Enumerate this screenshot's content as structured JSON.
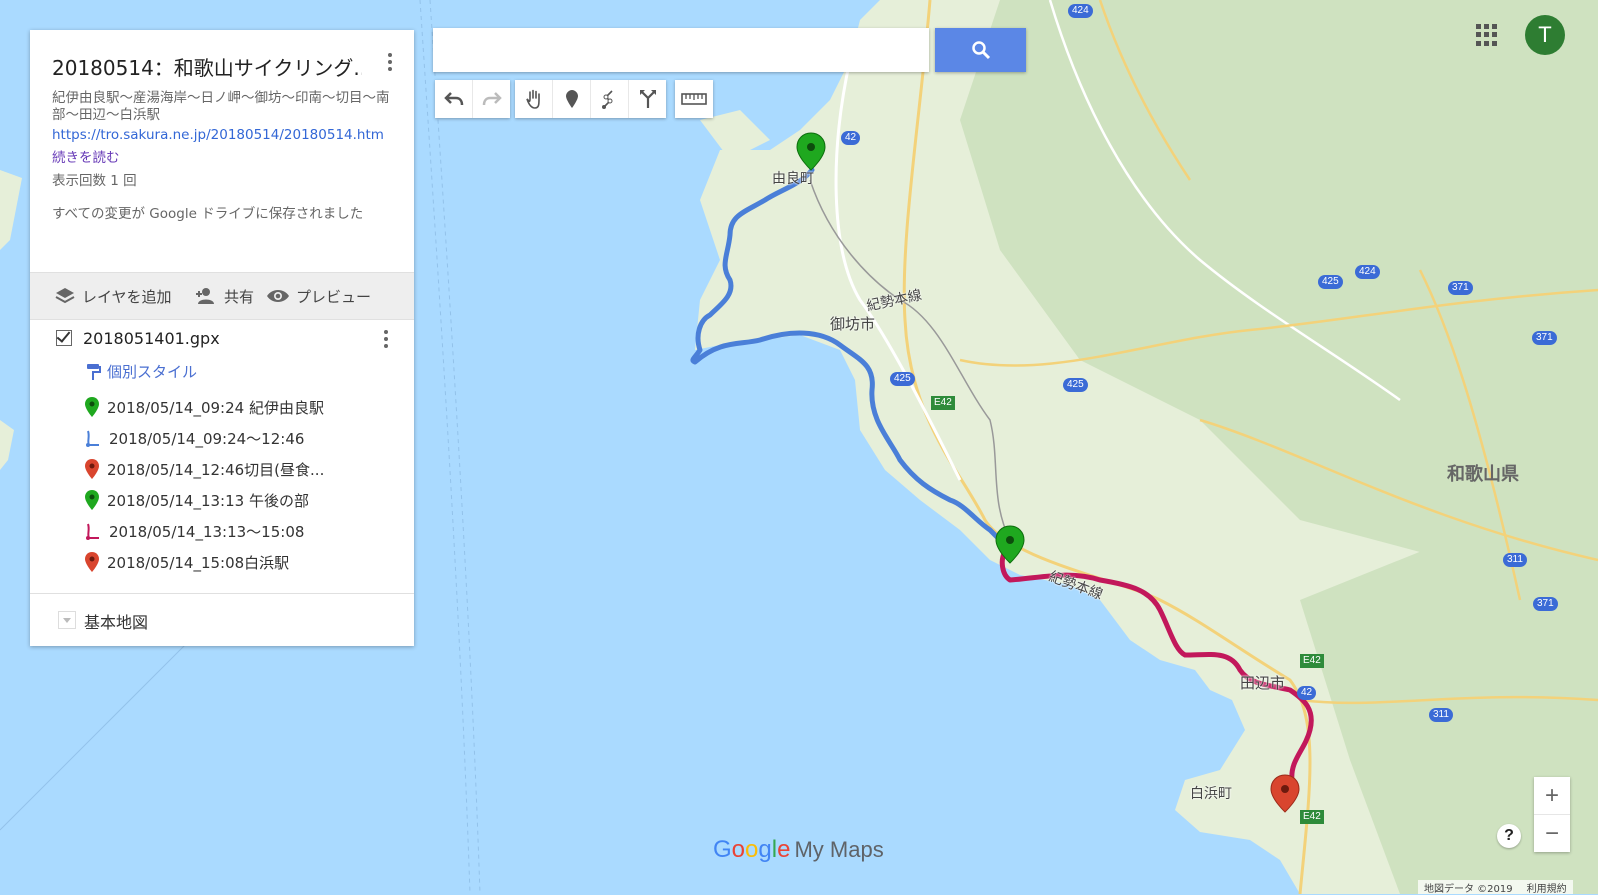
{
  "map_title": "20180514：和歌山サイクリング...",
  "description": "紀伊由良駅〜産湯海岸〜日ノ岬〜御坊〜印南〜切目〜南部〜田辺〜白浜駅",
  "link_text": "https://tro.sakura.ne.jp/20180514/20180514.htm",
  "read_more": "続きを読む",
  "view_count": "表示回数 1 回",
  "save_status": "すべての変更が Google ドライブに保存されました",
  "actions": {
    "add_layer": "レイヤを追加",
    "share": "共有",
    "preview": "プレビュー"
  },
  "layer": {
    "name": "2018051401.gpx",
    "checked": true,
    "style_label": "個別スタイル",
    "features": [
      {
        "label": "2018/05/14_09:24 紀伊由良駅",
        "icon": "green-pin-icon",
        "color": "#1fa81f"
      },
      {
        "label": "2018/05/14_09:24〜12:46",
        "icon": "route-icon",
        "color": "#4a7fd8"
      },
      {
        "label": "2018/05/14_12:46切目(昼食...",
        "icon": "red-pin-icon",
        "color": "#d9452e"
      },
      {
        "label": "2018/05/14_13:13 午後の部",
        "icon": "green-pin-icon",
        "color": "#1fa81f"
      },
      {
        "label": "2018/05/14_13:13〜15:08",
        "icon": "route-icon",
        "color": "#c2185b"
      },
      {
        "label": "2018/05/14_15:08白浜駅",
        "icon": "red-pin-icon",
        "color": "#d9452e"
      }
    ]
  },
  "basemap_label": "基本地図",
  "search": {
    "value": "",
    "placeholder": ""
  },
  "toolbar_icons": [
    "undo-icon",
    "redo-icon",
    "hand-icon",
    "marker-icon",
    "draw-line-icon",
    "directions-icon",
    "ruler-icon"
  ],
  "user_initial": "T",
  "zoom": {
    "in": "+",
    "out": "−"
  },
  "help": "?",
  "logo": {
    "g": [
      "G",
      "o",
      "o",
      "g",
      "l",
      "e"
    ],
    "product": "My Maps"
  },
  "attribution": {
    "data": "地図データ ©2019",
    "terms": "利用規約"
  },
  "map_labels": {
    "yura": "由良町",
    "kisei_line_1": "紀勢本線",
    "gobo": "御坊市",
    "kisei_line_2": "紀勢本線",
    "tanabe": "田辺市",
    "shirahama": "白浜町",
    "wakayama_pref": "和歌山県"
  },
  "route_colors": {
    "morning": "#4a7fd8",
    "afternoon": "#c2185b"
  },
  "colors": {
    "water": "#aadaff",
    "land": "#e6efd9",
    "search_button": "#5b87e6",
    "avatar": "#2e7d32"
  }
}
